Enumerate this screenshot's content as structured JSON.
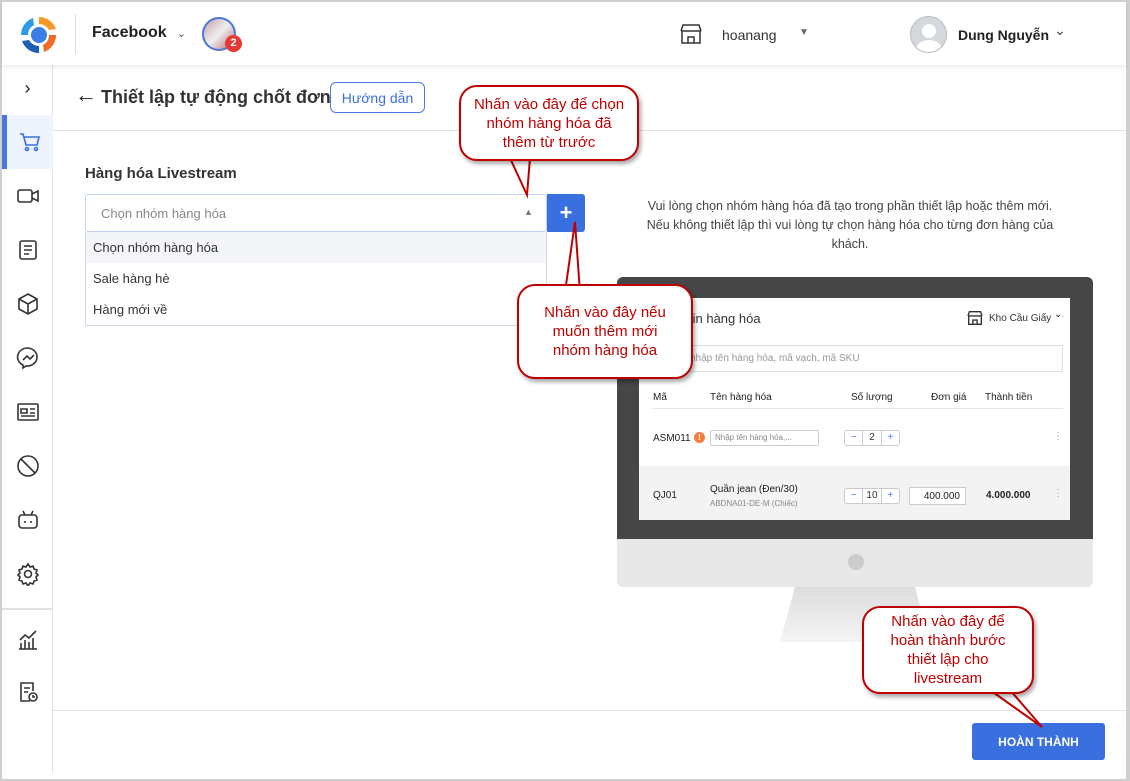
{
  "header": {
    "app_name": "Facebook",
    "notification_count": "2",
    "shop_name": "hoanang",
    "user_name": "Dung Nguyễn"
  },
  "page": {
    "title": "Thiết lập tự động chốt đơn",
    "guide_button": "Hướng dẫn"
  },
  "form": {
    "section_label": "Hàng hóa Livestream",
    "select_placeholder": "Chọn nhóm hàng hóa",
    "add_button": "+",
    "options": [
      "Chọn nhóm hàng hóa",
      "Sale hàng hè",
      "Hàng mới về"
    ]
  },
  "info_text": "Vui lòng chọn nhóm hàng hóa đã tạo trong phần thiết lập hoặc thêm mới. Nếu không thiết lập thì vui lòng tự chọn hàng hóa cho từng đơn hàng của khách.",
  "preview": {
    "title": "tin hàng hóa",
    "warehouse": "Kho Cầu Giấy",
    "search_placeholder": "nhập tên hàng hóa, mã vạch, mã SKU",
    "columns": [
      "Mã",
      "Tên hàng hóa",
      "Số lượng",
      "Đơn giá",
      "Thành tiền"
    ],
    "rows": [
      {
        "code": "ASM011",
        "name_placeholder": "Nhập tên hàng hóa,...",
        "qty": "2"
      },
      {
        "code": "QJ01",
        "name": "Quần jean (Đen/30)",
        "sku": "ABDNA01-DE-M (Chiếc)",
        "qty": "10",
        "price": "400.000",
        "total": "4.000.000"
      }
    ]
  },
  "callouts": {
    "select_group": "Nhấn vào đây để chọn nhóm hàng hóa đã thêm từ trước",
    "add_group": "Nhấn vào đây nếu muốn thêm mới nhóm hàng hóa",
    "finish": "Nhấn vào đây để hoàn thành bước thiết lập cho livestream"
  },
  "footer": {
    "finish_button": "HOÀN THÀNH"
  },
  "colors": {
    "accent": "#3a6fe0",
    "callout": "#c00000"
  }
}
